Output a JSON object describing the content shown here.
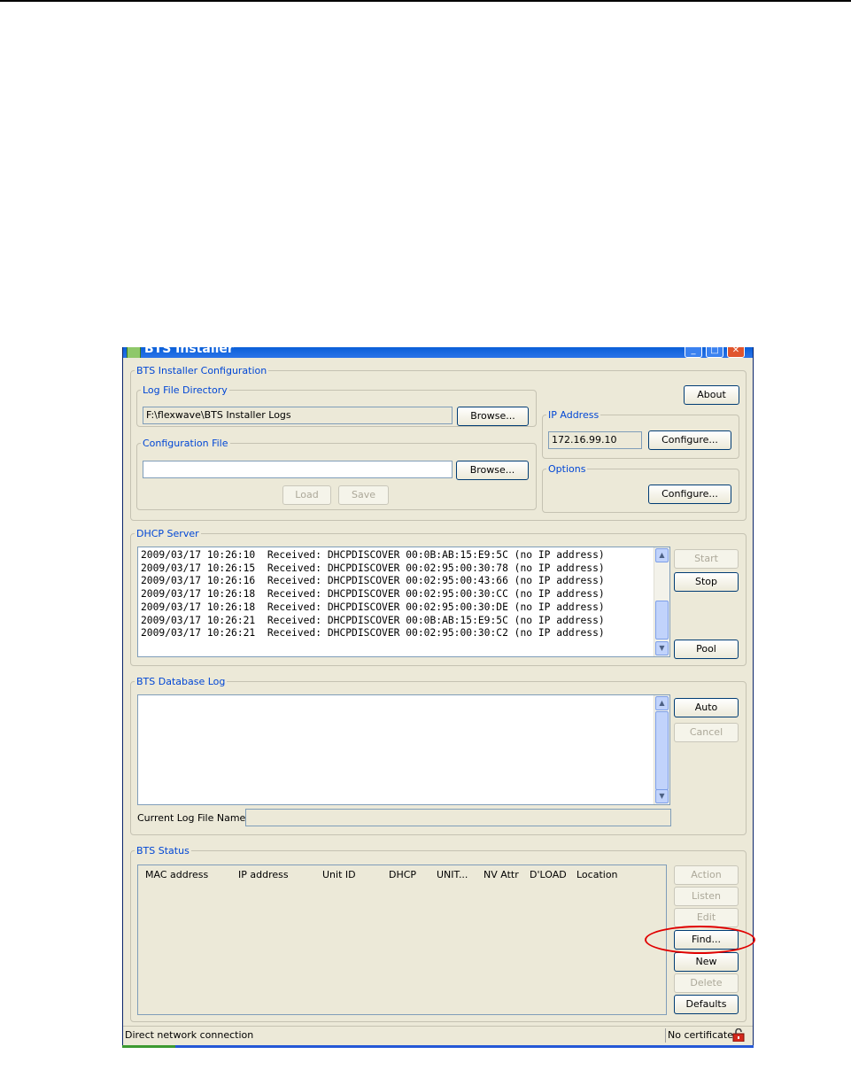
{
  "window": {
    "title": "BTS Installer",
    "controls": {
      "minimize": "_",
      "maximize": "□",
      "close": "✕"
    }
  },
  "config": {
    "legend": "BTS Installer Configuration",
    "log_dir": {
      "legend": "Log File Directory",
      "value": "F:\\flexwave\\BTS Installer Logs",
      "browse_label": "Browse..."
    },
    "config_file": {
      "legend": "Configuration File",
      "value": "",
      "browse_label": "Browse...",
      "load_label": "Load",
      "save_label": "Save"
    },
    "about_label": "About",
    "ip": {
      "legend": "IP Address",
      "value": "172.16.99.10",
      "configure_label": "Configure..."
    },
    "options": {
      "legend": "Options",
      "configure_label": "Configure..."
    }
  },
  "dhcp": {
    "legend": "DHCP Server",
    "log_lines": [
      "2009/03/17 10:26:10  Received: DHCPDISCOVER 00:0B:AB:15:E9:5C (no IP address)",
      "2009/03/17 10:26:15  Received: DHCPDISCOVER 00:02:95:00:30:78 (no IP address)",
      "2009/03/17 10:26:16  Received: DHCPDISCOVER 00:02:95:00:43:66 (no IP address)",
      "2009/03/17 10:26:18  Received: DHCPDISCOVER 00:02:95:00:30:CC (no IP address)",
      "2009/03/17 10:26:18  Received: DHCPDISCOVER 00:02:95:00:30:DE (no IP address)",
      "2009/03/17 10:26:21  Received: DHCPDISCOVER 00:0B:AB:15:E9:5C (no IP address)",
      "2009/03/17 10:26:21  Received: DHCPDISCOVER 00:02:95:00:30:C2 (no IP address)"
    ],
    "start_label": "Start",
    "stop_label": "Stop",
    "pool_label": "Pool"
  },
  "dblog": {
    "legend": "BTS Database Log",
    "auto_label": "Auto",
    "cancel_label": "Cancel",
    "current_log_label": "Current Log File Name:",
    "current_log_value": ""
  },
  "status": {
    "legend": "BTS Status",
    "columns": [
      "MAC address",
      "IP address",
      "Unit ID",
      "DHCP",
      "UNIT...",
      "NV Attr",
      "D'LOAD",
      "Location"
    ],
    "buttons": {
      "action": "Action",
      "listen": "Listen",
      "edit": "Edit",
      "find": "Find...",
      "new": "New",
      "delete": "Delete",
      "defaults": "Defaults"
    }
  },
  "statusbar": {
    "connection": "Direct network connection",
    "certificate": "No certificate"
  },
  "colors": {
    "window_bg": "#ece9d8",
    "legend_text": "#0046d5",
    "titlebar": "#0a5fd8",
    "highlight": "#e00000"
  },
  "icons": [
    "app-icon",
    "minimize-icon",
    "maximize-icon",
    "close-icon",
    "scroll-up-icon",
    "scroll-down-icon",
    "lock-icon"
  ]
}
